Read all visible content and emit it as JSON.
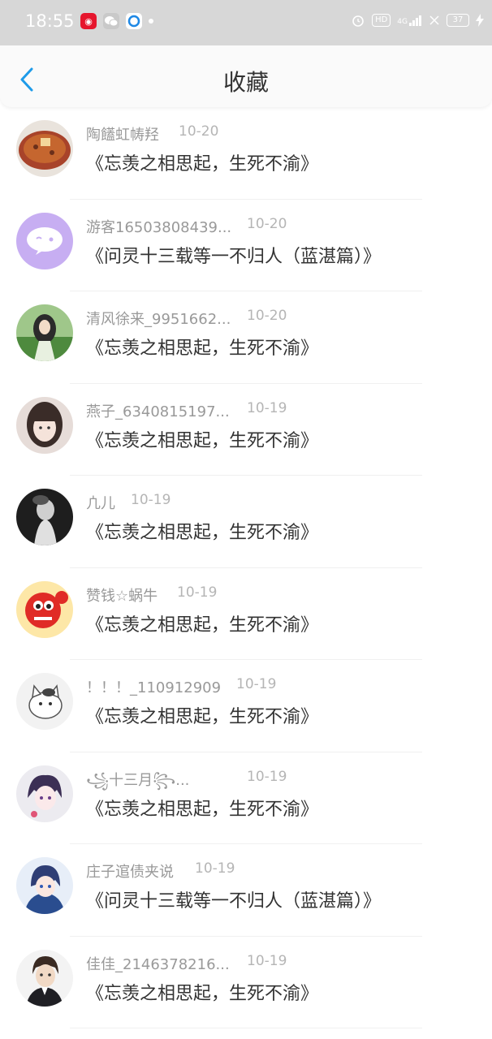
{
  "status_bar": {
    "time": "18:55",
    "badge_hd": "HD",
    "badge_4g": "4G",
    "battery": "37"
  },
  "header": {
    "title": "收藏"
  },
  "items": [
    {
      "name": "陶饚虹帱羟",
      "date": "10-20",
      "title": "《忘羡之相思起，生死不渝》"
    },
    {
      "name": "游客16503808439...",
      "date": "10-20",
      "title": "《问灵十三载等一不归人（蓝湛篇）》"
    },
    {
      "name": "清风徐来_9951662...",
      "date": "10-20",
      "title": "《忘羡之相思起，生死不渝》"
    },
    {
      "name": "燕子_6340815197...",
      "date": "10-19",
      "title": "《忘羡之相思起，生死不渝》"
    },
    {
      "name": "凣儿",
      "date": "10-19",
      "title": "《忘羡之相思起，生死不渝》"
    },
    {
      "name": "赞钱☆蜗牛",
      "date": "10-19",
      "title": "《忘羡之相思起，生死不渝》"
    },
    {
      "name": "！！！_110912909",
      "date": "10-19",
      "title": "《忘羡之相思起，生死不渝》"
    },
    {
      "name": "꧁十三月꧂...",
      "date": "10-19",
      "title": "《忘羡之相思起，生死不渝》"
    },
    {
      "name": "庄子逭债夹说",
      "date": "10-19",
      "title": "《问灵十三载等一不归人（蓝湛篇）》"
    },
    {
      "name": "佳佳_2146378216...",
      "date": "10-19",
      "title": "《忘羡之相思起，生死不渝》"
    }
  ]
}
